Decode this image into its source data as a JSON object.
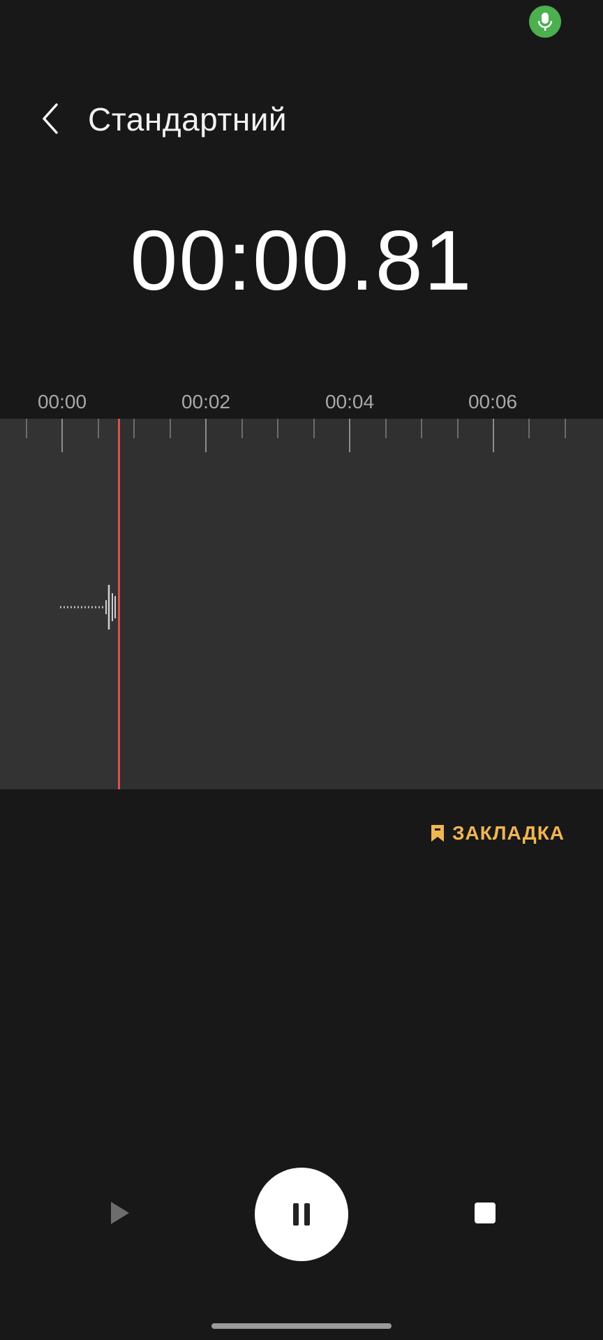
{
  "status_bar": {
    "mic_indicator_icon": "microphone-icon",
    "mic_indicator_color": "#4caf50"
  },
  "header": {
    "back_icon": "chevron-left-icon",
    "title": "Стандартний"
  },
  "recorder": {
    "elapsed_time": "00:00.81",
    "timeline_labels": [
      "00:00",
      "00:02",
      "00:04",
      "00:06"
    ],
    "playhead_color": "#d9534f"
  },
  "bookmark": {
    "icon": "bookmark-icon",
    "label": "ЗАКЛАДКА",
    "color": "#f0b652"
  },
  "controls": {
    "play_icon": "play-icon",
    "pause_icon": "pause-icon",
    "stop_icon": "stop-icon"
  }
}
